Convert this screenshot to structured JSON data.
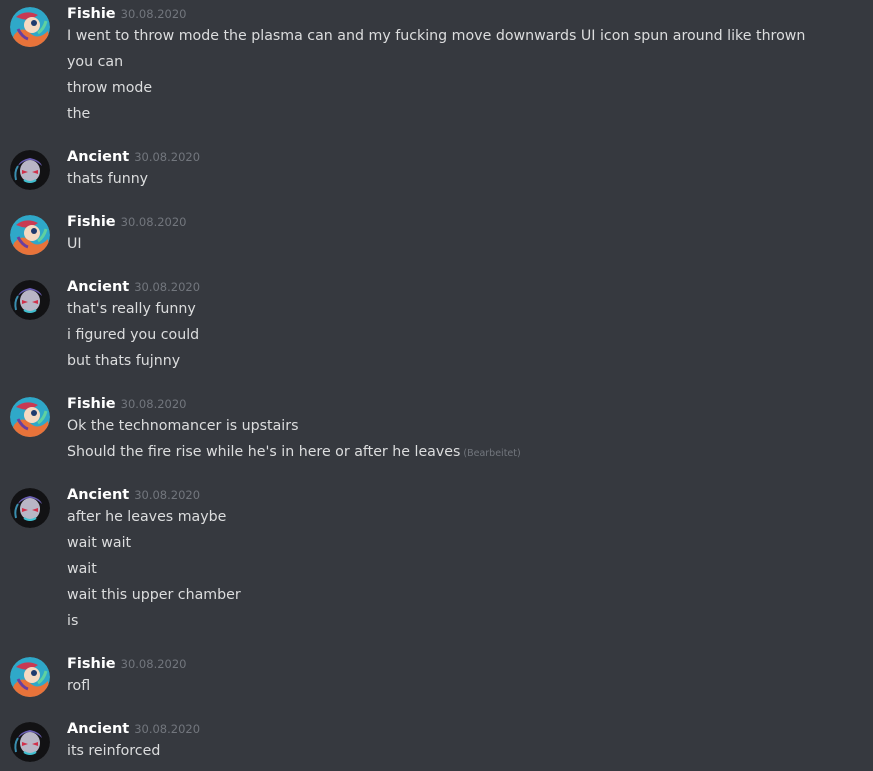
{
  "users": {
    "fishie": {
      "name": "Fishie"
    },
    "ancient": {
      "name": "Ancient"
    }
  },
  "colors": {
    "background": "#36393f",
    "username": "#ffffff",
    "message_text": "#dcddde",
    "muted": "#72767d"
  },
  "groups": [
    {
      "author": "Fishie",
      "timestamp": "30.08.2020",
      "lines": [
        {
          "text": "I went to throw mode the plasma can and my fucking move downwards UI icon spun around like thrown"
        },
        {
          "text": "you can"
        },
        {
          "text": "throw mode"
        },
        {
          "text": "the"
        }
      ]
    },
    {
      "author": "Ancient",
      "timestamp": "30.08.2020",
      "lines": [
        {
          "text": "thats funny"
        }
      ]
    },
    {
      "author": "Fishie",
      "timestamp": "30.08.2020",
      "lines": [
        {
          "text": "UI"
        }
      ]
    },
    {
      "author": "Ancient",
      "timestamp": "30.08.2020",
      "lines": [
        {
          "text": "that's really funny"
        },
        {
          "text": "i figured you could"
        },
        {
          "text": "but thats fujnny"
        }
      ]
    },
    {
      "author": "Fishie",
      "timestamp": "30.08.2020",
      "lines": [
        {
          "text": "Ok the technomancer is upstairs"
        },
        {
          "text": "Should the fire rise while he's in here or after he leaves",
          "edited": "(Bearbeitet)"
        }
      ]
    },
    {
      "author": "Ancient",
      "timestamp": "30.08.2020",
      "lines": [
        {
          "text": "after he leaves maybe"
        },
        {
          "text": "wait wait"
        },
        {
          "text": "wait"
        },
        {
          "text": "wait this upper chamber"
        },
        {
          "text": "is"
        }
      ]
    },
    {
      "author": "Fishie",
      "timestamp": "30.08.2020",
      "lines": [
        {
          "text": "rofl"
        }
      ]
    },
    {
      "author": "Ancient",
      "timestamp": "30.08.2020",
      "lines": [
        {
          "text": "its reinforced"
        }
      ]
    }
  ]
}
